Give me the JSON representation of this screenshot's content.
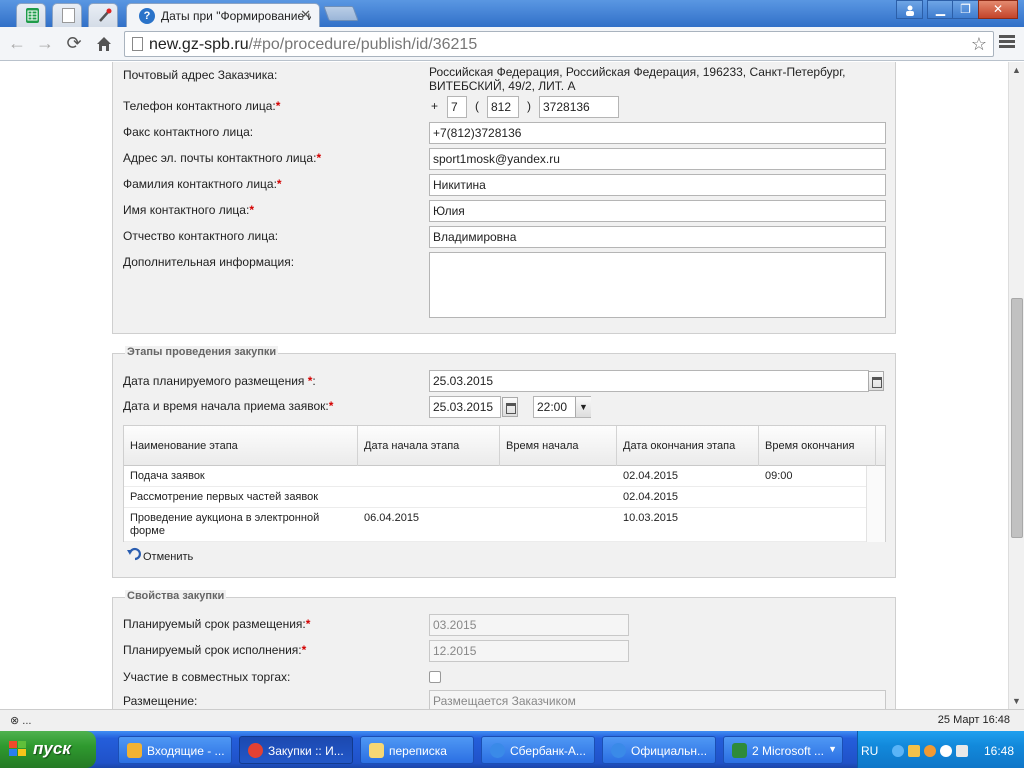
{
  "browser": {
    "tabs": [
      {
        "title": "",
        "icon": "spreadsheet-icon",
        "pinned": true
      },
      {
        "title": "",
        "icon": "document-icon",
        "pinned": true
      },
      {
        "title": "",
        "icon": "tools-icon",
        "pinned": true
      },
      {
        "title": "Даты при \"Формирование и",
        "icon": "help-icon",
        "pinned": false,
        "active": true
      }
    ],
    "url_host": "new.gz-spb.ru",
    "url_path": "/#po/procedure/publish/id/36215"
  },
  "contact": {
    "postal_address_label": "Почтовый адрес Заказчика:",
    "postal_address_value_line1": "Российская Федерация, Российская Федерация, 196233, Санкт-Петербург,",
    "postal_address_value_line2": "ВИТЕБСКИЙ, 49/2, ЛИТ. А",
    "phone_label": "Телефон контактного лица:",
    "phone_plus": "+",
    "phone_country": "7",
    "phone_open": "(",
    "phone_code": "812",
    "phone_close": ")",
    "phone_number": "3728136",
    "fax_label": "Факс контактного лица:",
    "fax_value": "+7(812)3728136",
    "email_label": "Адрес эл. почты контактного лица:",
    "email_value": "sport1mosk@yandex.ru",
    "surname_label": "Фамилия контактного лица:",
    "surname_value": "Никитина",
    "name_label": "Имя контактного лица:",
    "name_value": "Юлия",
    "patronymic_label": "Отчество контактного лица:",
    "patronymic_value": "Владимировна",
    "extra_label": "Дополнительная информация:",
    "extra_value": "",
    "required_mark": "*"
  },
  "stages": {
    "legend": "Этапы проведения закупки",
    "planned_date_label": "Дата планируемого размещения ",
    "planned_date_suffix": ":",
    "planned_date_value": "25.03.2015",
    "start_label": "Дата и время начала приема заявок:",
    "start_date_value": "25.03.2015",
    "start_time_value": "22:00",
    "columns": [
      "Наименование этапа",
      "Дата начала этапа",
      "Время начала",
      "Дата окончания этапа",
      "Время окончания"
    ],
    "rows": [
      {
        "name": "Подача заявок",
        "start_date": "",
        "start_time": "",
        "end_date": "02.04.2015",
        "end_time": "09:00"
      },
      {
        "name": "Рассмотрение первых частей заявок",
        "start_date": "",
        "start_time": "",
        "end_date": "02.04.2015",
        "end_time": ""
      },
      {
        "name": "Проведение аукциона в электронной форме",
        "start_date": "06.04.2015",
        "start_time": "",
        "end_date": "10.03.2015",
        "end_time": ""
      }
    ],
    "undo_label": "Отменить"
  },
  "props": {
    "legend": "Свойства закупки",
    "placement_term_label": "Планируемый срок размещения:",
    "placement_term_value": "03.2015",
    "execution_term_label": "Планируемый срок исполнения:",
    "execution_term_value": "12.2015",
    "joint_label": "Участие в совместных торгах:",
    "joint_checked": false,
    "placement_label": "Размещение:",
    "placement_value": "Размещается Заказчиком"
  },
  "status": {
    "left": "⊗ ...",
    "right": "25 Март 16:48"
  },
  "taskbar": {
    "start_label": "пуск",
    "tasks": [
      {
        "label": "Входящие - ...",
        "icon_color": "#f2b233"
      },
      {
        "label": "Закупки :: И...",
        "icon_color": "#e34133",
        "active": true
      },
      {
        "label": "переписка",
        "icon_color": "#f7d774"
      },
      {
        "label": "Сбербанк-А...",
        "icon_color": "#3a8ae8"
      },
      {
        "label": "Официальн...",
        "icon_color": "#3a8ae8"
      },
      {
        "label": "2 Microsoft ...",
        "icon_color": "#2e8b3a"
      }
    ],
    "lang": "RU",
    "clock": "16:48"
  }
}
